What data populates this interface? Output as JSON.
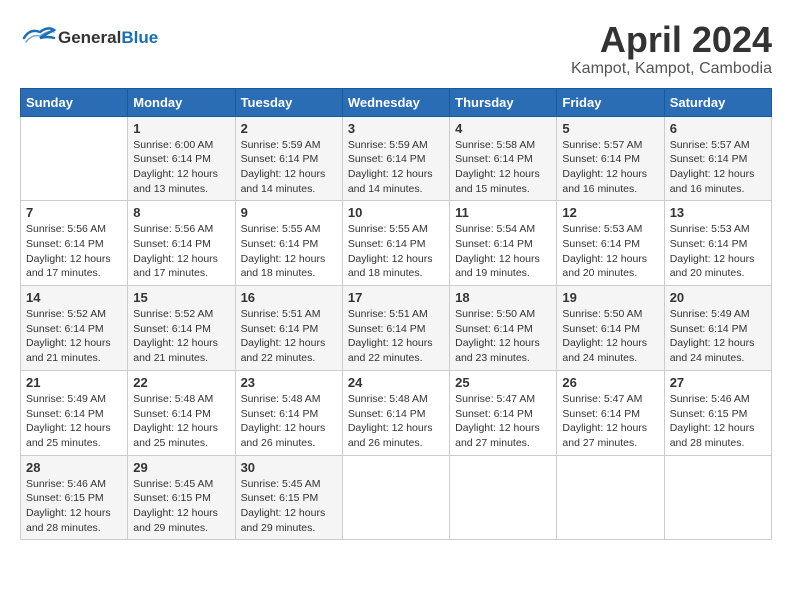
{
  "header": {
    "logo_text_general": "General",
    "logo_text_blue": "Blue",
    "title": "April 2024",
    "subtitle": "Kampot, Kampot, Cambodia"
  },
  "calendar": {
    "columns": [
      "Sunday",
      "Monday",
      "Tuesday",
      "Wednesday",
      "Thursday",
      "Friday",
      "Saturday"
    ],
    "rows": [
      [
        {
          "day": "",
          "info": ""
        },
        {
          "day": "1",
          "info": "Sunrise: 6:00 AM\nSunset: 6:14 PM\nDaylight: 12 hours\nand 13 minutes."
        },
        {
          "day": "2",
          "info": "Sunrise: 5:59 AM\nSunset: 6:14 PM\nDaylight: 12 hours\nand 14 minutes."
        },
        {
          "day": "3",
          "info": "Sunrise: 5:59 AM\nSunset: 6:14 PM\nDaylight: 12 hours\nand 14 minutes."
        },
        {
          "day": "4",
          "info": "Sunrise: 5:58 AM\nSunset: 6:14 PM\nDaylight: 12 hours\nand 15 minutes."
        },
        {
          "day": "5",
          "info": "Sunrise: 5:57 AM\nSunset: 6:14 PM\nDaylight: 12 hours\nand 16 minutes."
        },
        {
          "day": "6",
          "info": "Sunrise: 5:57 AM\nSunset: 6:14 PM\nDaylight: 12 hours\nand 16 minutes."
        }
      ],
      [
        {
          "day": "7",
          "info": "Sunrise: 5:56 AM\nSunset: 6:14 PM\nDaylight: 12 hours\nand 17 minutes."
        },
        {
          "day": "8",
          "info": "Sunrise: 5:56 AM\nSunset: 6:14 PM\nDaylight: 12 hours\nand 17 minutes."
        },
        {
          "day": "9",
          "info": "Sunrise: 5:55 AM\nSunset: 6:14 PM\nDaylight: 12 hours\nand 18 minutes."
        },
        {
          "day": "10",
          "info": "Sunrise: 5:55 AM\nSunset: 6:14 PM\nDaylight: 12 hours\nand 18 minutes."
        },
        {
          "day": "11",
          "info": "Sunrise: 5:54 AM\nSunset: 6:14 PM\nDaylight: 12 hours\nand 19 minutes."
        },
        {
          "day": "12",
          "info": "Sunrise: 5:53 AM\nSunset: 6:14 PM\nDaylight: 12 hours\nand 20 minutes."
        },
        {
          "day": "13",
          "info": "Sunrise: 5:53 AM\nSunset: 6:14 PM\nDaylight: 12 hours\nand 20 minutes."
        }
      ],
      [
        {
          "day": "14",
          "info": "Sunrise: 5:52 AM\nSunset: 6:14 PM\nDaylight: 12 hours\nand 21 minutes."
        },
        {
          "day": "15",
          "info": "Sunrise: 5:52 AM\nSunset: 6:14 PM\nDaylight: 12 hours\nand 21 minutes."
        },
        {
          "day": "16",
          "info": "Sunrise: 5:51 AM\nSunset: 6:14 PM\nDaylight: 12 hours\nand 22 minutes."
        },
        {
          "day": "17",
          "info": "Sunrise: 5:51 AM\nSunset: 6:14 PM\nDaylight: 12 hours\nand 22 minutes."
        },
        {
          "day": "18",
          "info": "Sunrise: 5:50 AM\nSunset: 6:14 PM\nDaylight: 12 hours\nand 23 minutes."
        },
        {
          "day": "19",
          "info": "Sunrise: 5:50 AM\nSunset: 6:14 PM\nDaylight: 12 hours\nand 24 minutes."
        },
        {
          "day": "20",
          "info": "Sunrise: 5:49 AM\nSunset: 6:14 PM\nDaylight: 12 hours\nand 24 minutes."
        }
      ],
      [
        {
          "day": "21",
          "info": "Sunrise: 5:49 AM\nSunset: 6:14 PM\nDaylight: 12 hours\nand 25 minutes."
        },
        {
          "day": "22",
          "info": "Sunrise: 5:48 AM\nSunset: 6:14 PM\nDaylight: 12 hours\nand 25 minutes."
        },
        {
          "day": "23",
          "info": "Sunrise: 5:48 AM\nSunset: 6:14 PM\nDaylight: 12 hours\nand 26 minutes."
        },
        {
          "day": "24",
          "info": "Sunrise: 5:48 AM\nSunset: 6:14 PM\nDaylight: 12 hours\nand 26 minutes."
        },
        {
          "day": "25",
          "info": "Sunrise: 5:47 AM\nSunset: 6:14 PM\nDaylight: 12 hours\nand 27 minutes."
        },
        {
          "day": "26",
          "info": "Sunrise: 5:47 AM\nSunset: 6:14 PM\nDaylight: 12 hours\nand 27 minutes."
        },
        {
          "day": "27",
          "info": "Sunrise: 5:46 AM\nSunset: 6:15 PM\nDaylight: 12 hours\nand 28 minutes."
        }
      ],
      [
        {
          "day": "28",
          "info": "Sunrise: 5:46 AM\nSunset: 6:15 PM\nDaylight: 12 hours\nand 28 minutes."
        },
        {
          "day": "29",
          "info": "Sunrise: 5:45 AM\nSunset: 6:15 PM\nDaylight: 12 hours\nand 29 minutes."
        },
        {
          "day": "30",
          "info": "Sunrise: 5:45 AM\nSunset: 6:15 PM\nDaylight: 12 hours\nand 29 minutes."
        },
        {
          "day": "",
          "info": ""
        },
        {
          "day": "",
          "info": ""
        },
        {
          "day": "",
          "info": ""
        },
        {
          "day": "",
          "info": ""
        }
      ]
    ]
  }
}
